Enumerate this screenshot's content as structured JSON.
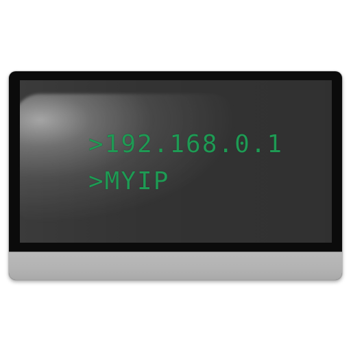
{
  "terminal": {
    "lines": [
      ">192.168.0.1",
      ">MYIP"
    ],
    "text_color": "#1f9a54"
  },
  "monitor": {
    "bezel_color": "#0b0b0b",
    "screen_color": "#333333",
    "chin_color": "#b5b5b5"
  }
}
